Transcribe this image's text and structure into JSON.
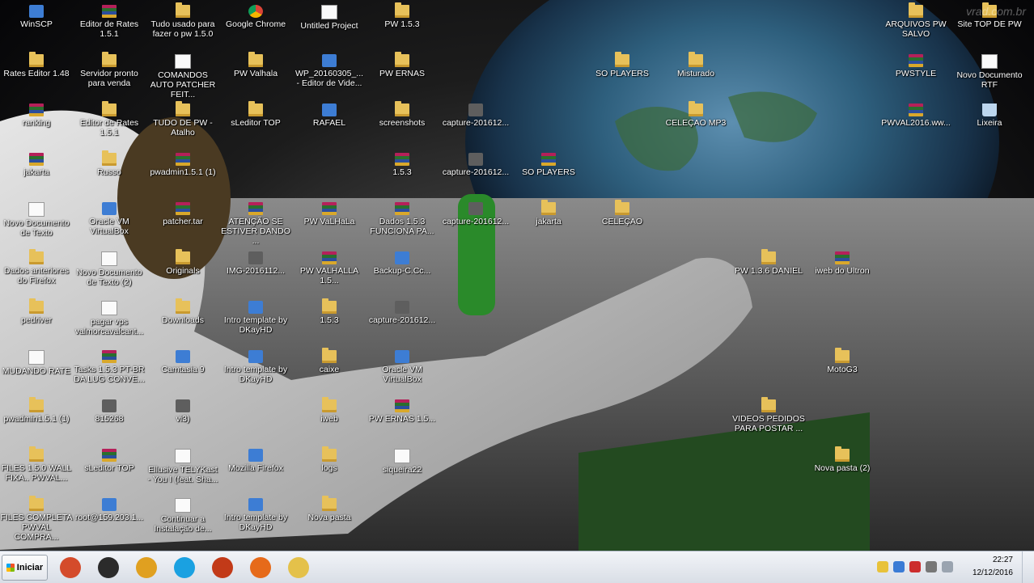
{
  "desktop": {
    "watermark": "vrad.com.br",
    "icons": [
      {
        "label": "WinSCP",
        "type": "exe"
      },
      {
        "label": "Editor de Rates 1.5.1",
        "type": "rar"
      },
      {
        "label": "Tudo usado para fazer o pw 1.5.0",
        "type": "folder"
      },
      {
        "label": "Google Chrome",
        "type": "chrome"
      },
      {
        "label": "Untitled Project",
        "type": "doc"
      },
      {
        "label": "PW 1.5.3",
        "type": "folder"
      },
      {
        "label": "ARQUIVOS PW SALVO",
        "type": "folder"
      },
      {
        "label": "Site TOP DE PW",
        "type": "folder"
      },
      {
        "label": "Rates Editor 1.48",
        "type": "folder"
      },
      {
        "label": "Servidor pronto para venda",
        "type": "folder"
      },
      {
        "label": "COMANDOS AUTO PATCHER FEIT...",
        "type": "doc"
      },
      {
        "label": "PW Valhala",
        "type": "folder"
      },
      {
        "label": "WP_20160305_... - Editor de Vide...",
        "type": "exe"
      },
      {
        "label": "PW ERNAS",
        "type": "folder"
      },
      {
        "label": "SO PLAYERS",
        "type": "folder"
      },
      {
        "label": "Misturado",
        "type": "folder"
      },
      {
        "label": "PWSTYLE",
        "type": "rar"
      },
      {
        "label": "Novo Documento RTF",
        "type": "doc"
      },
      {
        "label": "ranking",
        "type": "rar"
      },
      {
        "label": "Editor de Rates 1.5.1",
        "type": "folder"
      },
      {
        "label": "TUDO DE PW - Atalho",
        "type": "folder"
      },
      {
        "label": "sLeditor TOP",
        "type": "folder"
      },
      {
        "label": "RAFAEL",
        "type": "exe"
      },
      {
        "label": "screenshots",
        "type": "folder"
      },
      {
        "label": "capture-201612...",
        "type": "app"
      },
      {
        "label": "CELEÇAO MP3",
        "type": "folder"
      },
      {
        "label": "PWVAL2016.ww...",
        "type": "rar"
      },
      {
        "label": "Lixeira",
        "type": "trash"
      },
      {
        "label": "jakarta",
        "type": "rar"
      },
      {
        "label": "Russo",
        "type": "folder"
      },
      {
        "label": "pwadmin1.5.1 (1)",
        "type": "rar"
      },
      {
        "label": "1.5.3",
        "type": "rar"
      },
      {
        "label": "capture-201612...",
        "type": "app"
      },
      {
        "label": "SO PLAYERS",
        "type": "rar"
      },
      {
        "label": "Novo Documento de Texto",
        "type": "doc"
      },
      {
        "label": "Oracle VM VirtualBox",
        "type": "exe"
      },
      {
        "label": "patcher.tar",
        "type": "rar"
      },
      {
        "label": "ATENÇÃO SE ESTIVER DANDO ...",
        "type": "rar"
      },
      {
        "label": "PW VaLHaLa",
        "type": "rar"
      },
      {
        "label": "Dados 1.5.3 FUNCIONA PA...",
        "type": "rar"
      },
      {
        "label": "capture-201612...",
        "type": "app"
      },
      {
        "label": "jakarta",
        "type": "folder"
      },
      {
        "label": "CELEÇAO",
        "type": "folder"
      },
      {
        "label": "Dados anteriores do Firefox",
        "type": "folder"
      },
      {
        "label": "Novo Documento de Texto (2)",
        "type": "doc"
      },
      {
        "label": "Originals",
        "type": "folder"
      },
      {
        "label": "IMG-2016112...",
        "type": "app"
      },
      {
        "label": "PW VALHALLA 1.5...",
        "type": "rar"
      },
      {
        "label": "Backup-C.Cc...",
        "type": "exe"
      },
      {
        "label": "PW 1.3.6 DANIEL",
        "type": "folder"
      },
      {
        "label": "iweb do Ultron",
        "type": "rar"
      },
      {
        "label": "pedriver",
        "type": "folder"
      },
      {
        "label": "pagar vps valmorcavalcant...",
        "type": "doc"
      },
      {
        "label": "Downloads",
        "type": "folder"
      },
      {
        "label": "Intro template by DKayHD",
        "type": "exe"
      },
      {
        "label": "1.5.3",
        "type": "folder"
      },
      {
        "label": "capture-201612...",
        "type": "app"
      },
      {
        "label": "MUDANDO RATE",
        "type": "doc"
      },
      {
        "label": "Tasks 1.5.3 PT-BR DA LUG CONVE...",
        "type": "rar"
      },
      {
        "label": "Camtasia 9",
        "type": "exe"
      },
      {
        "label": "Intro template by DKayHD",
        "type": "exe"
      },
      {
        "label": "caixe",
        "type": "folder"
      },
      {
        "label": "Oracle VM VirtualBox",
        "type": "exe"
      },
      {
        "label": "MotoG3",
        "type": "folder"
      },
      {
        "label": "pwadmin1.5.1 (1)",
        "type": "folder"
      },
      {
        "label": "815268",
        "type": "app"
      },
      {
        "label": "vi3)",
        "type": "app"
      },
      {
        "label": "iweb",
        "type": "folder"
      },
      {
        "label": "PW ERNAS 1.5...",
        "type": "rar"
      },
      {
        "label": "VIDEOS PEDIDOS PARA POSTAR ...",
        "type": "folder"
      },
      {
        "label": "FILES 1.5.0 WALL FIXA.. PWVAL...",
        "type": "folder"
      },
      {
        "label": "sLeditor TOP",
        "type": "rar"
      },
      {
        "label": "Ellusive TELYKast - You I (feat. Sha...",
        "type": "doc"
      },
      {
        "label": "Mozilla Firefox",
        "type": "exe"
      },
      {
        "label": "logs",
        "type": "folder"
      },
      {
        "label": "siqueira22",
        "type": "doc"
      },
      {
        "label": "Nova pasta (2)",
        "type": "folder"
      },
      {
        "label": "FILES COMPLETA PWVAL COMPRA...",
        "type": "folder"
      },
      {
        "label": "root@159.203.1...",
        "type": "exe"
      },
      {
        "label": "Continuar a Instalação de...",
        "type": "doc"
      },
      {
        "label": "Intro template by DKayHD",
        "type": "exe"
      },
      {
        "label": "Nova pasta",
        "type": "folder"
      }
    ]
  },
  "taskbar": {
    "start_label": "Iniciar",
    "apps": [
      {
        "name": "recorder",
        "color": "#d44b2b"
      },
      {
        "name": "obs",
        "color": "#2b2b2b"
      },
      {
        "name": "chrome",
        "color": "#e0a020"
      },
      {
        "name": "skype",
        "color": "#1aa1e1"
      },
      {
        "name": "game-launcher",
        "color": "#c23a18"
      },
      {
        "name": "firefox",
        "color": "#e66a1a"
      },
      {
        "name": "explorer",
        "color": "#e4c14a"
      }
    ],
    "clock_time": "22:27",
    "clock_date": "12/12/2016"
  }
}
